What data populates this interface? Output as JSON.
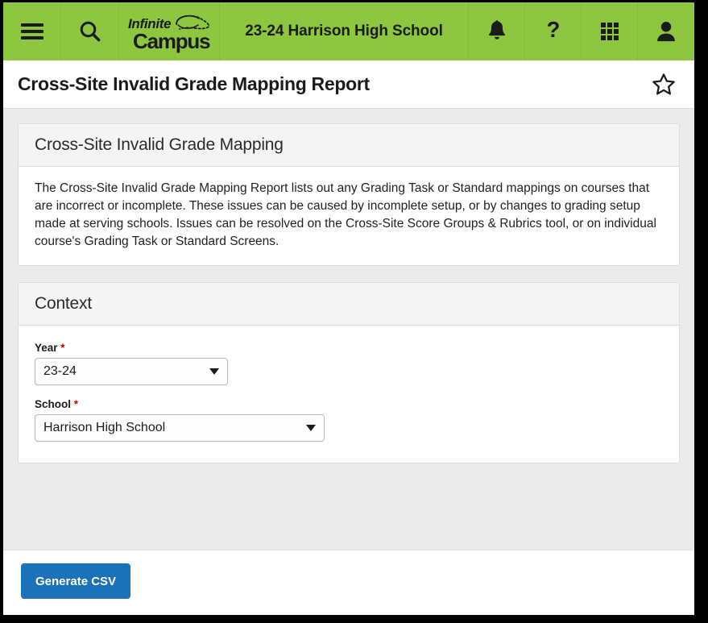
{
  "appbar": {
    "menu_icon": "hamburger-menu-icon",
    "search_icon": "search-icon",
    "logo_top": "Infinite",
    "logo_bottom": "Campus",
    "school_title": "23-24 Harrison High School",
    "notifications_icon": "bell-icon",
    "help_icon": "question-mark-icon",
    "apps_icon": "grid-apps-icon",
    "account_icon": "user-person-icon",
    "background_color": "#8DC63F"
  },
  "page": {
    "title": "Cross-Site Invalid Grade Mapping Report",
    "favorite_icon": "star-outline-icon"
  },
  "info_card": {
    "header": "Cross-Site Invalid Grade Mapping",
    "description": "The Cross-Site Invalid Grade Mapping Report lists out any Grading Task or Standard mappings on courses that are incorrect or incomplete. These issues can be caused by incomplete setup, or by changes to grading setup made at serving schools. Issues can be resolved on the Cross-Site Score Groups & Rubrics tool, or on individual course's Grading Task or Standard Screens."
  },
  "context_card": {
    "header": "Context",
    "fields": [
      {
        "label": "Year",
        "required_marker": "*",
        "value": "23-24",
        "caret_icon": "chevron-down-icon"
      },
      {
        "label": "School",
        "required_marker": "*",
        "value": "Harrison High School",
        "caret_icon": "chevron-down-icon"
      }
    ]
  },
  "footer": {
    "generate_button": "Generate CSV",
    "button_color": "#1C72B8"
  }
}
